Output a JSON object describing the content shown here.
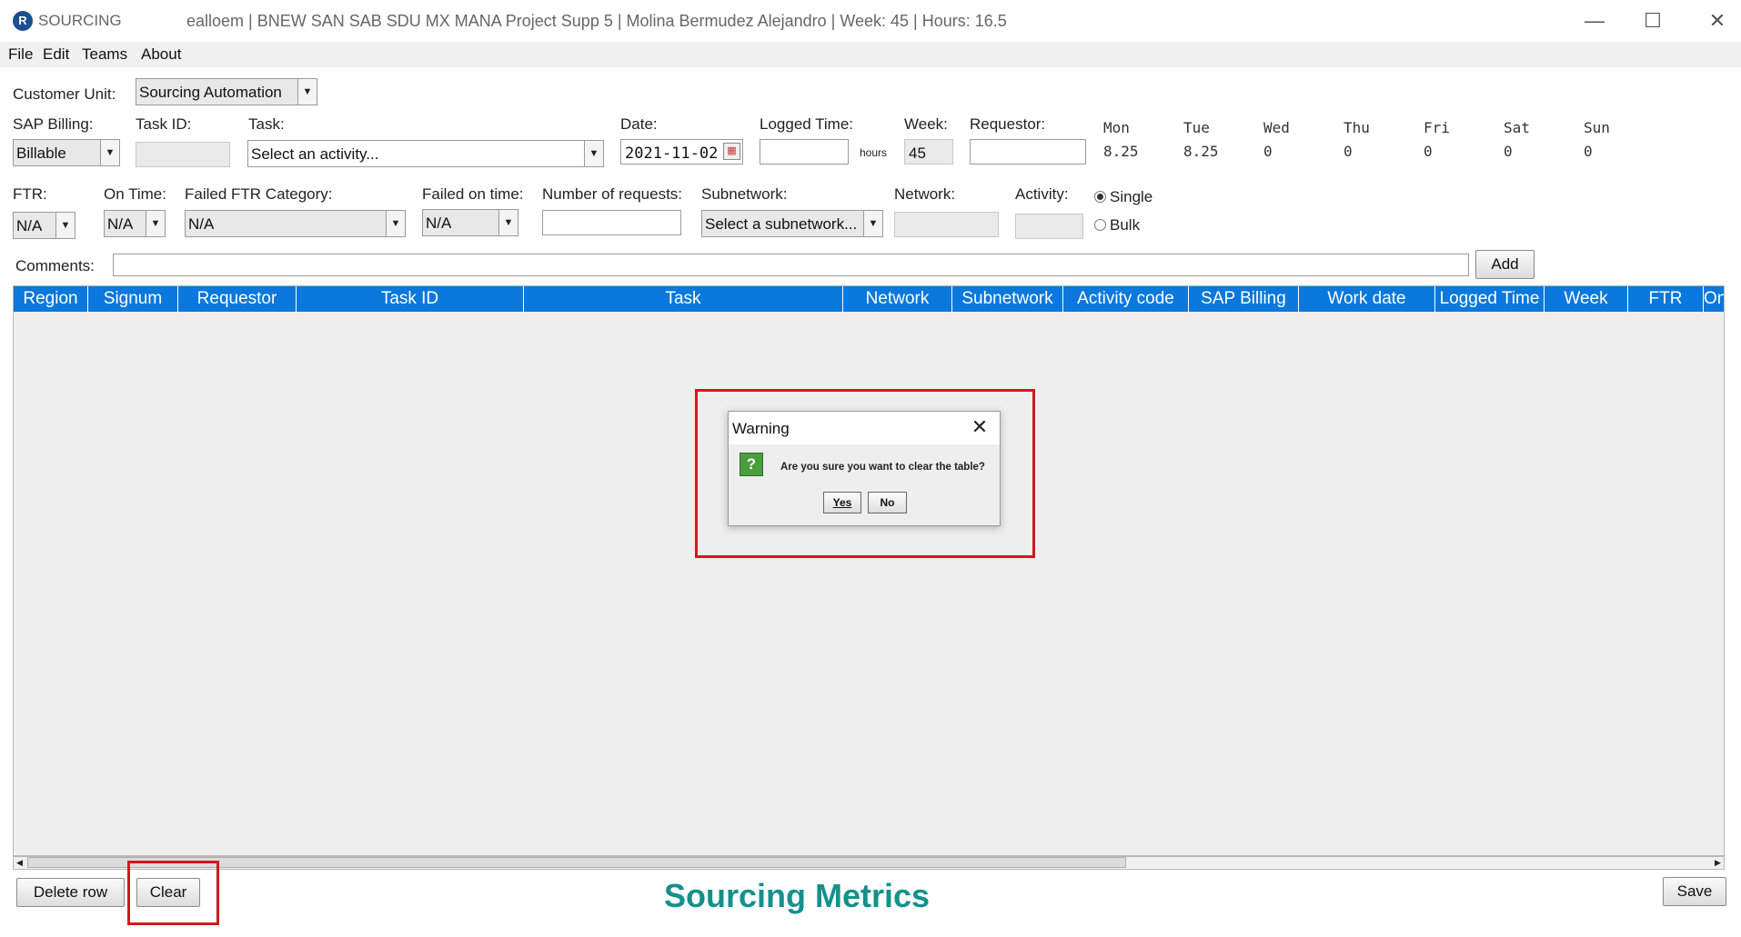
{
  "window": {
    "app_name": "SOURCING",
    "title": "ealloem | BNEW SAN SAB SDU MX MANA Project Supp 5 | Molina Bermudez Alejandro | Week: 45 | Hours: 16.5",
    "minimize": "—",
    "maximize": "☐",
    "close": "✕"
  },
  "menu": [
    "File",
    "Edit",
    "Teams",
    "About"
  ],
  "form": {
    "customer_unit": {
      "label": "Customer Unit:",
      "value": "Sourcing Automation"
    },
    "sap_billing": {
      "label": "SAP Billing:",
      "value": "Billable"
    },
    "task_id": {
      "label": "Task ID:",
      "value": ""
    },
    "task": {
      "label": "Task:",
      "value": "Select an activity..."
    },
    "date": {
      "label": "Date:",
      "value": "2021-11-02"
    },
    "logged_time": {
      "label": "Logged Time:",
      "value": "",
      "unit": "hours"
    },
    "week": {
      "label": "Week:",
      "value": "45"
    },
    "requestor": {
      "label": "Requestor:",
      "value": ""
    },
    "ftr": {
      "label": "FTR:",
      "value": "N/A"
    },
    "on_time": {
      "label": "On Time:",
      "value": "N/A"
    },
    "failed_ftr_category": {
      "label": "Failed FTR Category:",
      "value": "N/A"
    },
    "failed_on_time": {
      "label": "Failed on time:",
      "value": "N/A"
    },
    "number_of_requests": {
      "label": "Number of requests:",
      "value": ""
    },
    "subnetwork": {
      "label": "Subnetwork:",
      "value": "Select a subnetwork..."
    },
    "network": {
      "label": "Network:",
      "value": ""
    },
    "activity": {
      "label": "Activity:",
      "value": ""
    },
    "mode": {
      "single": "Single",
      "bulk": "Bulk",
      "selected": "Single"
    },
    "comments": {
      "label": "Comments:",
      "value": ""
    },
    "add_label": "Add"
  },
  "week_hours": [
    {
      "day": "Mon",
      "hours": "8.25"
    },
    {
      "day": "Tue",
      "hours": "8.25"
    },
    {
      "day": "Wed",
      "hours": "0"
    },
    {
      "day": "Thu",
      "hours": "0"
    },
    {
      "day": "Fri",
      "hours": "0"
    },
    {
      "day": "Sat",
      "hours": "0"
    },
    {
      "day": "Sun",
      "hours": "0"
    }
  ],
  "table": {
    "columns": [
      "Region",
      "Signum",
      "Requestor",
      "Task ID",
      "Task",
      "Network",
      "Subnetwork",
      "Activity code",
      "SAP Billing",
      "Work date",
      "Logged Time",
      "Week",
      "FTR",
      "On"
    ],
    "rows": []
  },
  "dialog": {
    "title": "Warning",
    "message": "Are you sure you want to clear the table?",
    "yes_label": "Yes",
    "no_label": "No",
    "icon": "?"
  },
  "footer": {
    "delete_row_label": "Delete row",
    "clear_label": "Clear",
    "title": "Sourcing Metrics",
    "save_label": "Save"
  },
  "colors": {
    "table_header": "#0a78dc",
    "highlight": "#d4161e",
    "metrics_title": "#13918a"
  }
}
